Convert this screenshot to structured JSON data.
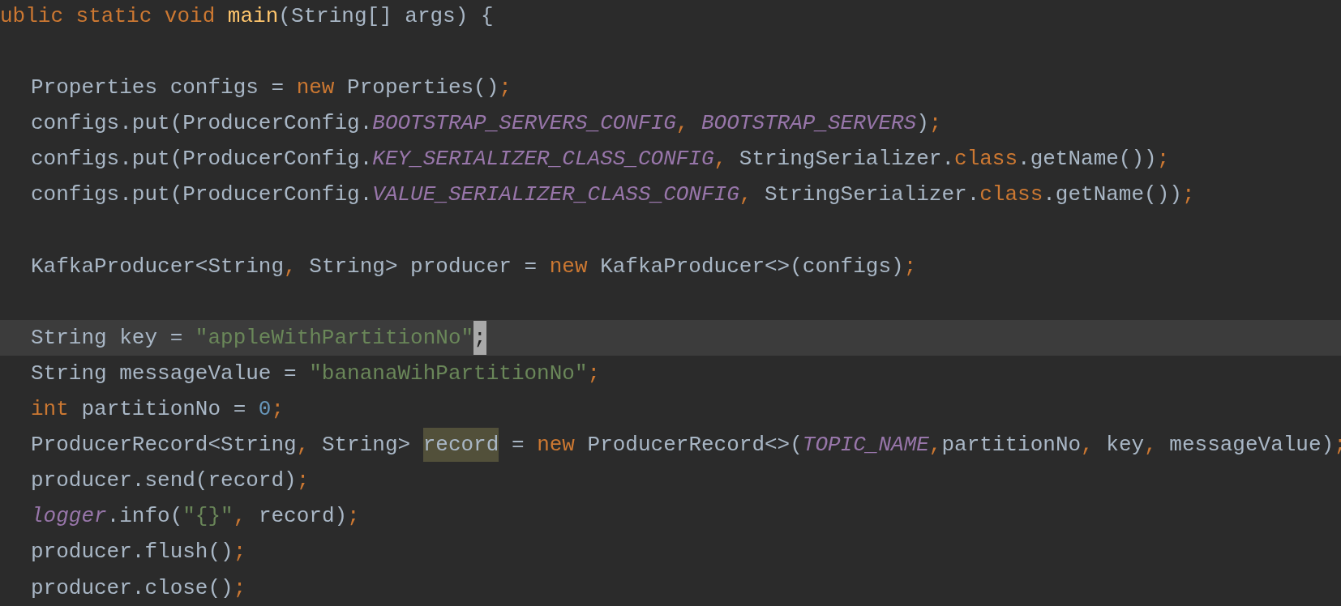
{
  "editor": {
    "lines": [
      {
        "current": false,
        "tokens": [
          {
            "kind": "keyword",
            "text": "ublic static void "
          },
          {
            "kind": "method",
            "text": "main"
          },
          {
            "kind": "plain",
            "text": "(String[] args) {"
          }
        ],
        "children": [
          {
            "current": false
          },
          {
            "current": false,
            "tokens": [
              {
                "kind": "plain",
                "text": "Properties configs = "
              },
              {
                "kind": "keyword",
                "text": "new "
              },
              {
                "kind": "plain",
                "text": "Properties()"
              },
              {
                "kind": "keyword",
                "text": ";"
              }
            ]
          },
          {
            "current": false,
            "tokens": [
              {
                "kind": "plain",
                "text": "configs.put(ProducerConfig."
              },
              {
                "kind": "constant",
                "text": "BOOTSTRAP_SERVERS_CONFIG"
              },
              {
                "kind": "keyword",
                "text": ", "
              },
              {
                "kind": "constant",
                "text": "BOOTSTRAP_SERVERS"
              },
              {
                "kind": "plain",
                "text": ")"
              },
              {
                "kind": "keyword",
                "text": ";"
              }
            ]
          },
          {
            "current": false,
            "tokens": [
              {
                "kind": "plain",
                "text": "configs.put(ProducerConfig."
              },
              {
                "kind": "constant",
                "text": "KEY_SERIALIZER_CLASS_CONFIG"
              },
              {
                "kind": "keyword",
                "text": ", "
              },
              {
                "kind": "plain",
                "text": "StringSerializer."
              },
              {
                "kind": "keyword",
                "text": "class"
              },
              {
                "kind": "plain",
                "text": ".getName())"
              },
              {
                "kind": "keyword",
                "text": ";"
              }
            ]
          },
          {
            "current": false,
            "tokens": [
              {
                "kind": "plain",
                "text": "configs.put(ProducerConfig."
              },
              {
                "kind": "constant",
                "text": "VALUE_SERIALIZER_CLASS_CONFIG"
              },
              {
                "kind": "keyword",
                "text": ", "
              },
              {
                "kind": "plain",
                "text": "StringSerializer."
              },
              {
                "kind": "keyword",
                "text": "class"
              },
              {
                "kind": "plain",
                "text": ".getName())"
              },
              {
                "kind": "keyword",
                "text": ";"
              }
            ]
          },
          {
            "current": false
          },
          {
            "current": false,
            "tokens": [
              {
                "kind": "plain",
                "text": "KafkaProducer<String"
              },
              {
                "kind": "keyword",
                "text": ", "
              },
              {
                "kind": "plain",
                "text": "String> producer = "
              },
              {
                "kind": "keyword",
                "text": "new "
              },
              {
                "kind": "plain",
                "text": "KafkaProducer<>(configs)"
              },
              {
                "kind": "keyword",
                "text": ";"
              }
            ]
          },
          {
            "current": false
          },
          {
            "current": true,
            "tokens": [
              {
                "kind": "plain",
                "text": "String key = "
              },
              {
                "kind": "string",
                "text": "\"appleWithPartitionNo\""
              },
              {
                "kind": "selection",
                "text": ";"
              }
            ]
          },
          {
            "current": false,
            "tokens": [
              {
                "kind": "plain",
                "text": "String messageValue = "
              },
              {
                "kind": "string",
                "text": "\"bananaWihPartitionNo\""
              },
              {
                "kind": "keyword",
                "text": ";"
              }
            ]
          },
          {
            "current": false,
            "tokens": [
              {
                "kind": "keyword",
                "text": "int "
              },
              {
                "kind": "plain",
                "text": "partitionNo = "
              },
              {
                "kind": "number",
                "text": "0"
              },
              {
                "kind": "keyword",
                "text": ";"
              }
            ]
          },
          {
            "current": false,
            "tokens": [
              {
                "kind": "plain",
                "text": "ProducerRecord<String"
              },
              {
                "kind": "keyword",
                "text": ", "
              },
              {
                "kind": "plain",
                "text": "String> "
              },
              {
                "kind": "usage",
                "text": "record"
              },
              {
                "kind": "plain",
                "text": " = "
              },
              {
                "kind": "keyword",
                "text": "new "
              },
              {
                "kind": "plain",
                "text": "ProducerRecord<>("
              },
              {
                "kind": "constant",
                "text": "TOPIC_NAME"
              },
              {
                "kind": "keyword",
                "text": ","
              },
              {
                "kind": "plain",
                "text": "partitionNo"
              },
              {
                "kind": "keyword",
                "text": ", "
              },
              {
                "kind": "plain",
                "text": "key"
              },
              {
                "kind": "keyword",
                "text": ", "
              },
              {
                "kind": "plain",
                "text": "messageValue)"
              },
              {
                "kind": "keyword",
                "text": ";"
              }
            ]
          },
          {
            "current": false,
            "tokens": [
              {
                "kind": "plain",
                "text": "producer.send(record)"
              },
              {
                "kind": "keyword",
                "text": ";"
              }
            ]
          },
          {
            "current": false,
            "tokens": [
              {
                "kind": "constant",
                "text": "logger"
              },
              {
                "kind": "plain",
                "text": ".info("
              },
              {
                "kind": "string",
                "text": "\"{}\""
              },
              {
                "kind": "keyword",
                "text": ", "
              },
              {
                "kind": "plain",
                "text": "record)"
              },
              {
                "kind": "keyword",
                "text": ";"
              }
            ]
          },
          {
            "current": false,
            "tokens": [
              {
                "kind": "plain",
                "text": "producer.flush()"
              },
              {
                "kind": "keyword",
                "text": ";"
              }
            ]
          },
          {
            "current": false,
            "tokens": [
              {
                "kind": "plain",
                "text": "producer.close()"
              },
              {
                "kind": "keyword",
                "text": ";"
              }
            ]
          }
        ]
      }
    ]
  }
}
